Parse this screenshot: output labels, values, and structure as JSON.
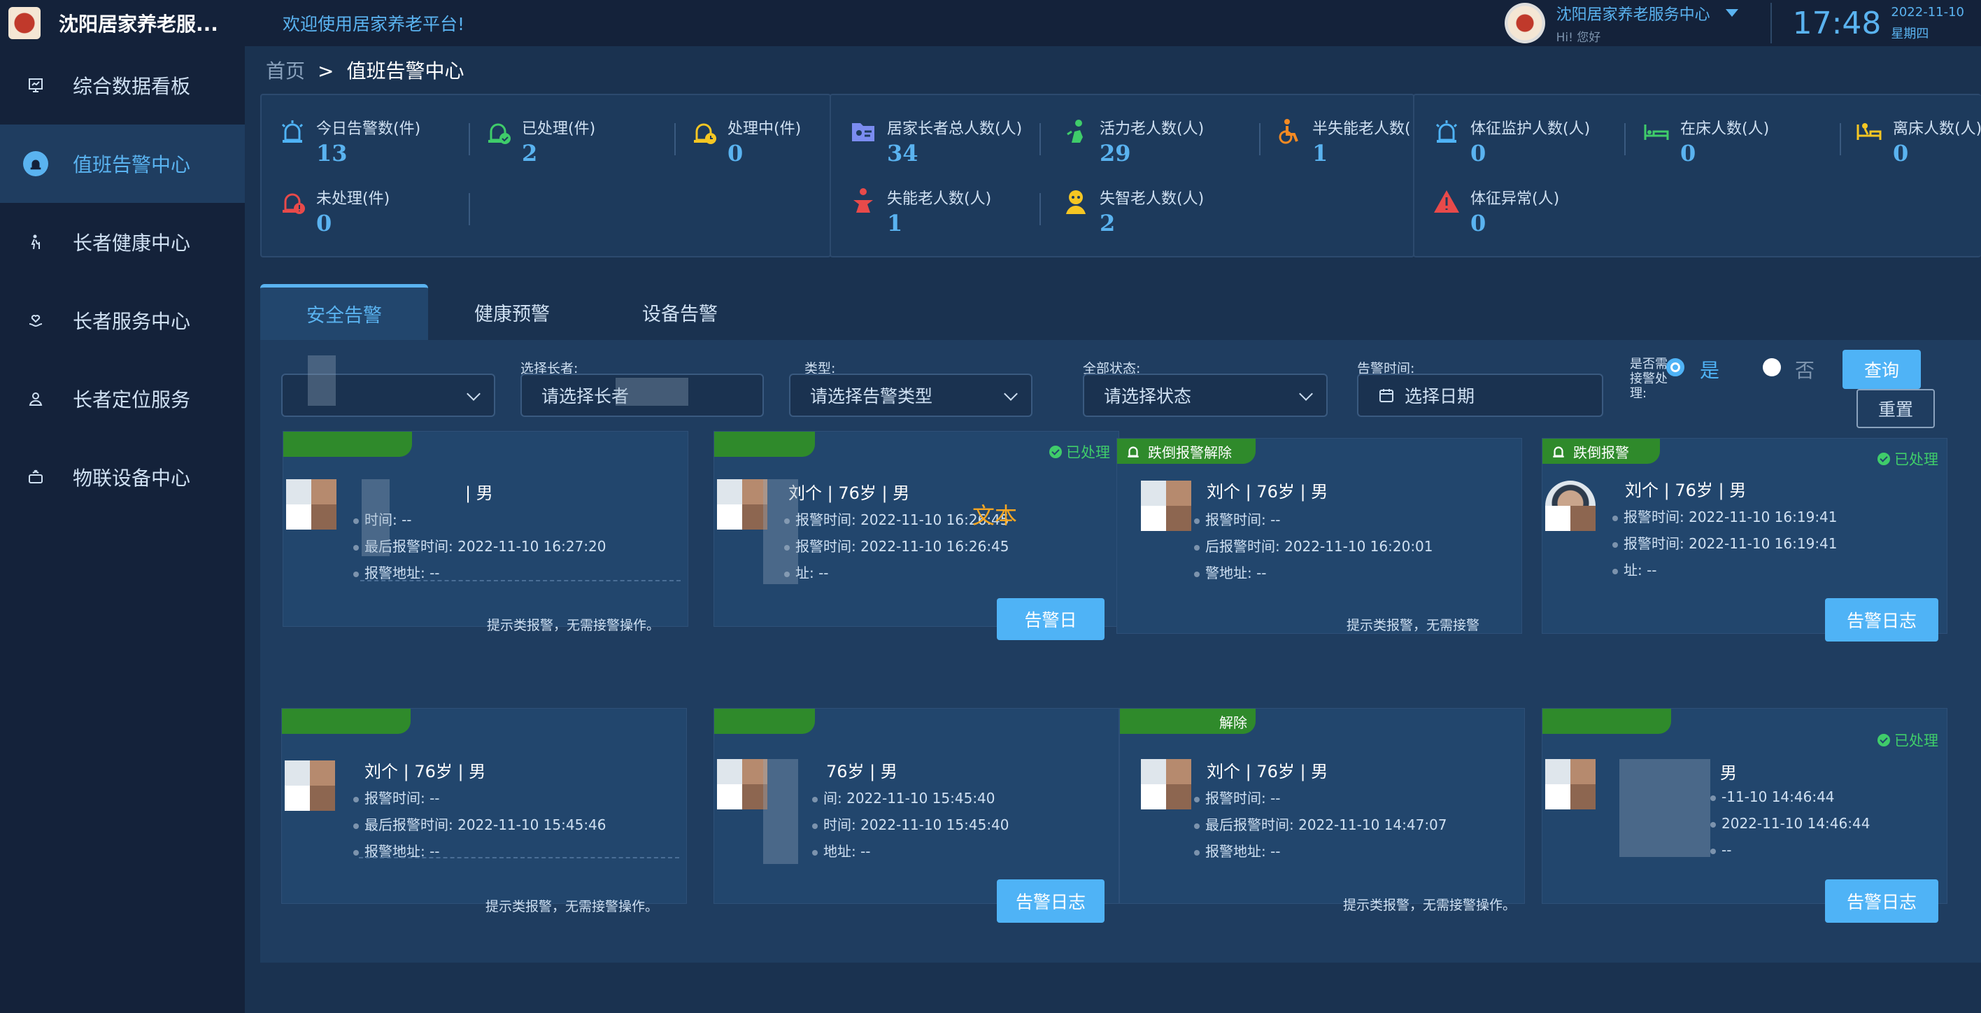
{
  "header": {
    "app_title": "沈阳居家养老服...",
    "welcome": "欢迎使用居家养老平台!",
    "org_name": "沈阳居家养老服务中心",
    "greeting": "Hi! 您好",
    "time": "17:48",
    "date": "2022-11-10",
    "weekday": "星期四"
  },
  "sidebar": {
    "items": [
      {
        "label": "综合数据看板",
        "icon": "dashboard-icon"
      },
      {
        "label": "值班告警中心",
        "icon": "alarm-icon"
      },
      {
        "label": "长者健康中心",
        "icon": "elder-icon"
      },
      {
        "label": "长者服务中心",
        "icon": "heart-hand-icon"
      },
      {
        "label": "长者定位服务",
        "icon": "location-person-icon"
      },
      {
        "label": "物联设备中心",
        "icon": "device-icon"
      }
    ],
    "active_index": 1
  },
  "breadcrumb": {
    "home": "首页",
    "separator": ">",
    "current": "值班告警中心"
  },
  "stats": {
    "alarms": [
      {
        "label": "今日告警数(件)",
        "value": "13",
        "color": "#4fb3f6"
      },
      {
        "label": "已处理(件)",
        "value": "2",
        "color": "#3fcc6a"
      },
      {
        "label": "处理中(件)",
        "value": "0",
        "color": "#f5c623"
      },
      {
        "label": "未处理(件)",
        "value": "0",
        "color": "#e84a4a"
      }
    ],
    "elders": [
      {
        "label": "居家长者总人数(人)",
        "value": "34",
        "color": "#7b8cf0"
      },
      {
        "label": "活力老人数(人)",
        "value": "29",
        "color": "#3fcc6a"
      },
      {
        "label": "半失能老人数(",
        "value": "1",
        "color": "#f58a23"
      },
      {
        "label": "失能老人数(人)",
        "value": "1",
        "color": "#e84a4a"
      },
      {
        "label": "失智老人数(人)",
        "value": "2",
        "color": "#f5c623"
      }
    ],
    "vitals": [
      {
        "label": "体征监护人数(人)",
        "value": "0",
        "color": "#4fb3f6"
      },
      {
        "label": "在床人数(人)",
        "value": "0",
        "color": "#3fcc6a"
      },
      {
        "label": "离床人数(人)",
        "value": "0",
        "color": "#f5c623"
      },
      {
        "label": "体征异常(人)",
        "value": "0",
        "color": "#e84a4a"
      }
    ]
  },
  "tabs": [
    "安全告警",
    "健康预警",
    "设备告警"
  ],
  "filters": {
    "elder_label": "选择长者:",
    "elder_placeholder": "请选择长者",
    "type_label": "类型:",
    "type_placeholder": "请选择告警类型",
    "status_label": "全部状态:",
    "status_placeholder": "请选择状态",
    "time_label": "告警时间:",
    "time_placeholder": "选择日期",
    "handle_label": "是否需接警处理:",
    "yes": "是",
    "no": "否",
    "query": "查询",
    "reset": "重置"
  },
  "float_text": "文本",
  "cards": [
    {
      "tag": "",
      "status": "",
      "name": "| 男",
      "l1": "时间: --",
      "l2": "最后报警时间: 2022-11-10 16:27:20",
      "l3": "报警地址: --",
      "hint": "提示类报警，无需接警操作。",
      "button": ""
    },
    {
      "tag": "",
      "status": "已处理",
      "name": "刘个 | 76岁 | 男",
      "l1": "报警时间: 2022-11-10 16:26:45",
      "l2": "报警时间: 2022-11-10 16:26:45",
      "l3": "址: --",
      "hint": "",
      "button": "告警日"
    },
    {
      "tag": "跌倒报警解除",
      "status": "",
      "name": "刘个 | 76岁 | 男",
      "l1": "报警时间: --",
      "l2": "后报警时间: 2022-11-10 16:20:01",
      "l3": "警地址: --",
      "hint": "提示类报警，无需接警",
      "button": ""
    },
    {
      "tag": "跌倒报警",
      "status": "已处理",
      "name": "刘个 | 76岁 | 男",
      "l1": "报警时间: 2022-11-10 16:19:41",
      "l2": "报警时间: 2022-11-10 16:19:41",
      "l3": "址: --",
      "hint": "",
      "button": "告警日志"
    },
    {
      "tag": "",
      "status": "",
      "name": "刘个 | 76岁 | 男",
      "l1": "报警时间: --",
      "l2": "最后报警时间: 2022-11-10 15:45:46",
      "l3": "报警地址: --",
      "hint": "提示类报警，无需接警操作。",
      "button": ""
    },
    {
      "tag": "",
      "status": "",
      "name": "76岁 | 男",
      "l1": "间: 2022-11-10 15:45:40",
      "l2": "时间: 2022-11-10 15:45:40",
      "l3": "地址: --",
      "hint": "",
      "button": "告警日志"
    },
    {
      "tag": "解除",
      "status": "",
      "name": "刘个 | 76岁 | 男",
      "l1": "报警时间: --",
      "l2": "最后报警时间: 2022-11-10 14:47:07",
      "l3": "报警地址: --",
      "hint": "提示类报警，无需接警操作。",
      "button": ""
    },
    {
      "tag": "",
      "status": "已处理",
      "name": "男",
      "l1": "-11-10 14:46:44",
      "l2": "2022-11-10 14:46:44",
      "l3": "--",
      "hint": "",
      "button": "告警日志"
    }
  ]
}
